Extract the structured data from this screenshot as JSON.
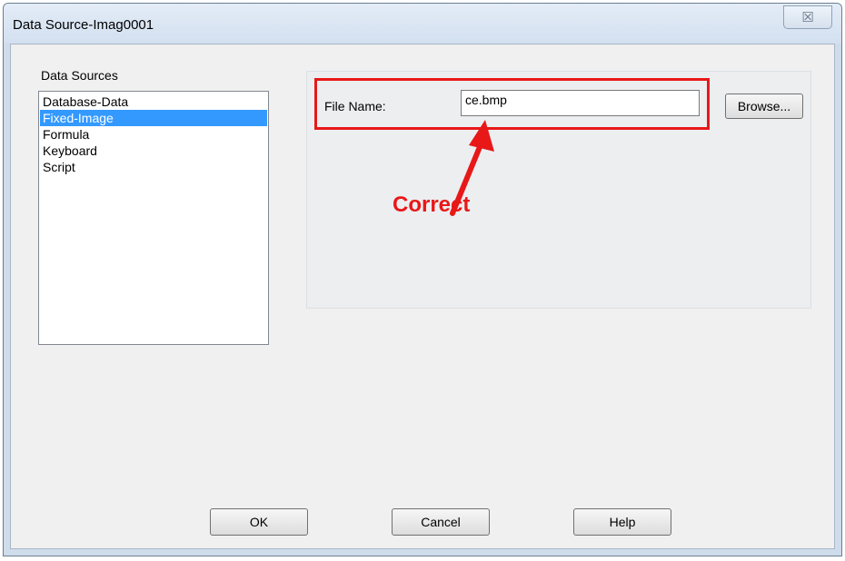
{
  "window": {
    "title": "Data Source-Imag0001",
    "close_glyph": "☒"
  },
  "data_sources": {
    "label": "Data Sources",
    "items": [
      {
        "label": "Database-Data",
        "selected": false
      },
      {
        "label": "Fixed-Image",
        "selected": true
      },
      {
        "label": "Formula",
        "selected": false
      },
      {
        "label": "Keyboard",
        "selected": false
      },
      {
        "label": "Script",
        "selected": false
      }
    ]
  },
  "file_name": {
    "label": "File Name:",
    "value": "ce.bmp",
    "browse_label": "Browse..."
  },
  "annotation": {
    "text": "Correct",
    "color": "#e81818"
  },
  "buttons": {
    "ok": "OK",
    "cancel": "Cancel",
    "help": "Help"
  },
  "colors": {
    "selection": "#3399ff",
    "highlight": "#e81818"
  }
}
